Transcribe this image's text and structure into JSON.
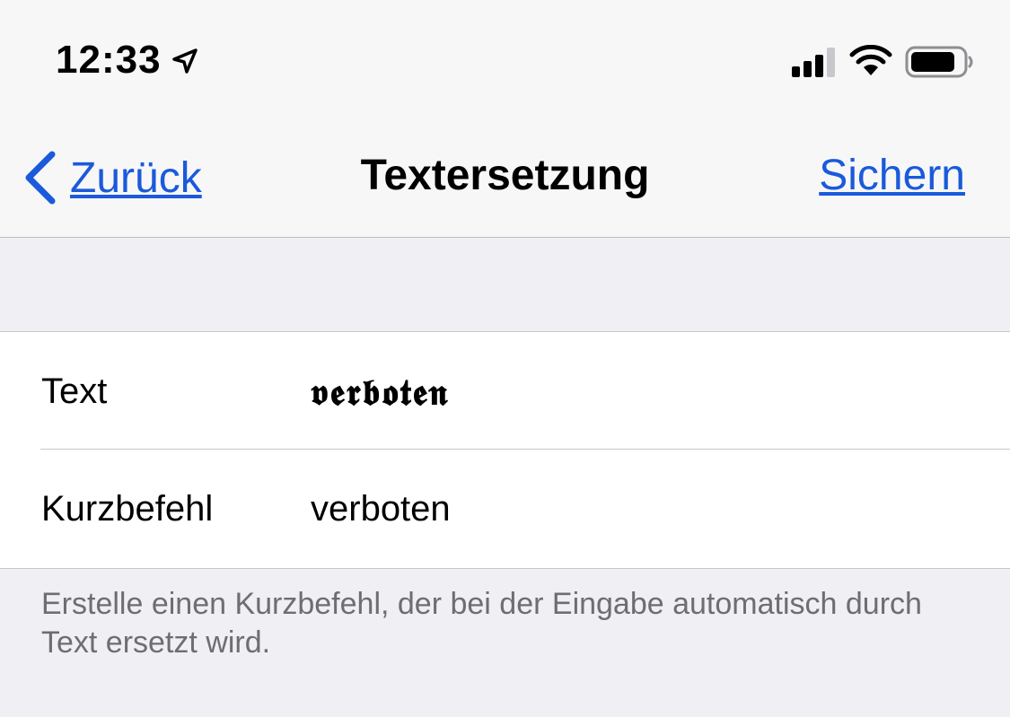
{
  "status_bar": {
    "time": "12:33",
    "icons": [
      "location-arrow-icon",
      "cellular-signal-icon",
      "wifi-icon",
      "battery-icon"
    ]
  },
  "nav": {
    "back_label": "Zurück",
    "title": "Textersetzung",
    "save_label": "Sichern",
    "accent_color": "#1a5adb"
  },
  "form": {
    "rows": [
      {
        "label": "Text",
        "value": "𝖛𝖊𝖗𝖇𝖔𝖙𝖊𝖓"
      },
      {
        "label": "Kurzbefehl",
        "value": "verboten"
      }
    ]
  },
  "footer_note": "Erstelle einen Kurzbefehl, der bei der Eingabe automatisch durch Text ersetzt wird."
}
